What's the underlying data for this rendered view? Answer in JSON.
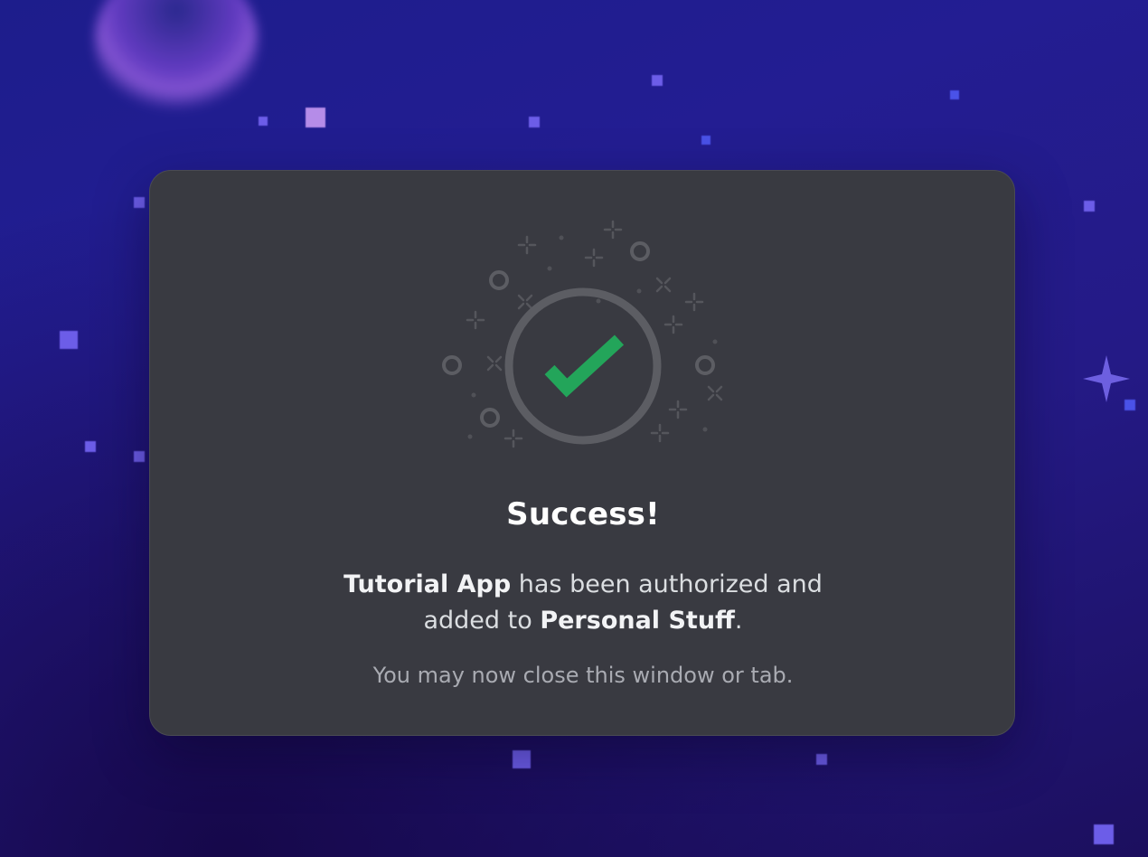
{
  "dialog": {
    "title": "Success!",
    "message": {
      "app_name": "Tutorial App",
      "middle_text": " has been authorized and",
      "line2_prefix": "added to ",
      "server_name": "Personal Stuff",
      "line2_suffix": "."
    },
    "hint": "You may now close this window or tab.",
    "icon": "checkmark-icon"
  },
  "colors": {
    "card_background": "#393a41",
    "check_green": "#23a55a",
    "ring_gray": "#5c5d63",
    "page_background": "#231d92"
  }
}
